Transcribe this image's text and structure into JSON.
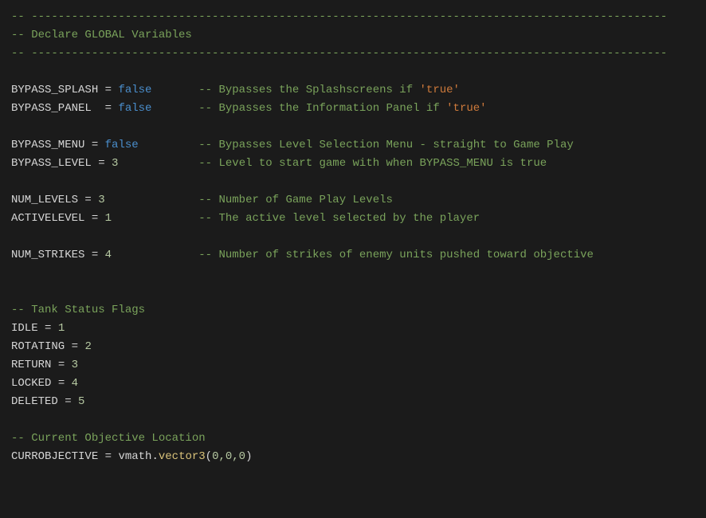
{
  "hdr": {
    "dash": "-- -----------------------------------------------------------------------------------------------",
    "title": "-- Declare GLOBAL Variables"
  },
  "v": {
    "splashVar": "BYPASS_SPLASH",
    "splashVal": "false",
    "splashCmt1": "-- Bypasses the Splashscreens if ",
    "splashCmt2": "'true'",
    "panelVar": "BYPASS_PANEL",
    "panelVal": "false",
    "panelCmt1": "-- Bypasses the Information Panel if ",
    "panelCmt2": "'true'",
    "menuVar": "BYPASS_MENU",
    "menuVal": "false",
    "menuCmt": "-- Bypasses Level Selection Menu - straight to Game Play",
    "levelVar": "BYPASS_LEVEL",
    "levelVal": "3",
    "levelCmt": "-- Level to start game with when BYPASS_MENU is true",
    "numLvlVar": "NUM_LEVELS",
    "numLvlVal": "3",
    "numLvlCmt": "-- Number of Game Play Levels",
    "actLvlVar": "ACTIVELEVEL",
    "actLvlVal": "1",
    "actLvlCmt": "-- The active level selected by the player",
    "strikesVar": "NUM_STRIKES",
    "strikesVal": "4",
    "strikesCmt": "-- Number of strikes of enemy units pushed toward objective",
    "tankHdr": "-- Tank Status Flags",
    "idleVar": "IDLE",
    "idleVal": "1",
    "rotVar": "ROTATING",
    "rotVal": "2",
    "retVar": "RETURN",
    "retVal": "3",
    "lockVar": "LOCKED",
    "lockVal": "4",
    "delVar": "DELETED",
    "delVal": "5",
    "objHdr": "-- Current Objective Location",
    "objVar": "CURROBJECTIVE",
    "objMod": "vmath",
    "objFn": "vector3",
    "objArgs": "0,0,0"
  }
}
